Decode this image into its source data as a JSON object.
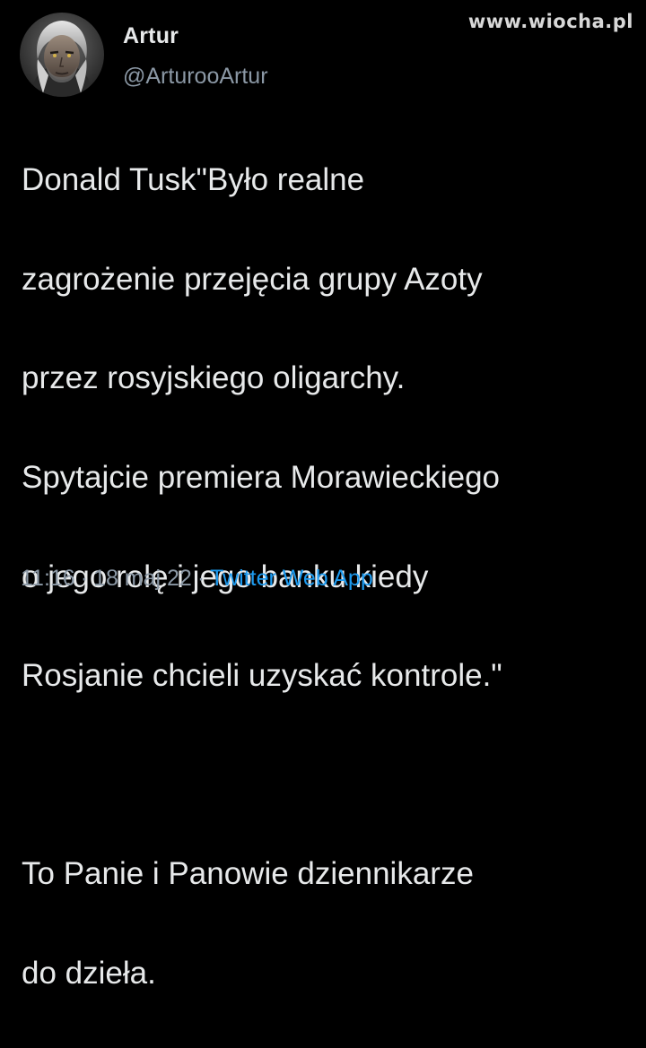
{
  "watermark": "www.wiocha.pl",
  "author": {
    "name": "Artur",
    "handle": "@ArturooArtur",
    "avatar_icon": "avatar-portrait-icon"
  },
  "tweet": {
    "text_lines": [
      "Donald Tusk\"Było realne",
      "zagrożenie przejęcia grupy Azoty",
      "przez rosyjskiego oligarchy.",
      "Spytajcie premiera Morawieckiego",
      "o jego rolę i jego banku kiedy",
      "Rosjanie chcieli uzyskać kontrole.\"",
      "",
      "To Panie i Panowie dziennikarze",
      "do dzieła."
    ],
    "time": "11:16",
    "date": "18 maj 22",
    "separator": "·",
    "source": "Twitter Web App"
  },
  "colors": {
    "background": "#000000",
    "text": "#e7e9ea",
    "secondary": "#8b98a5",
    "link": "#1d9bf0"
  }
}
